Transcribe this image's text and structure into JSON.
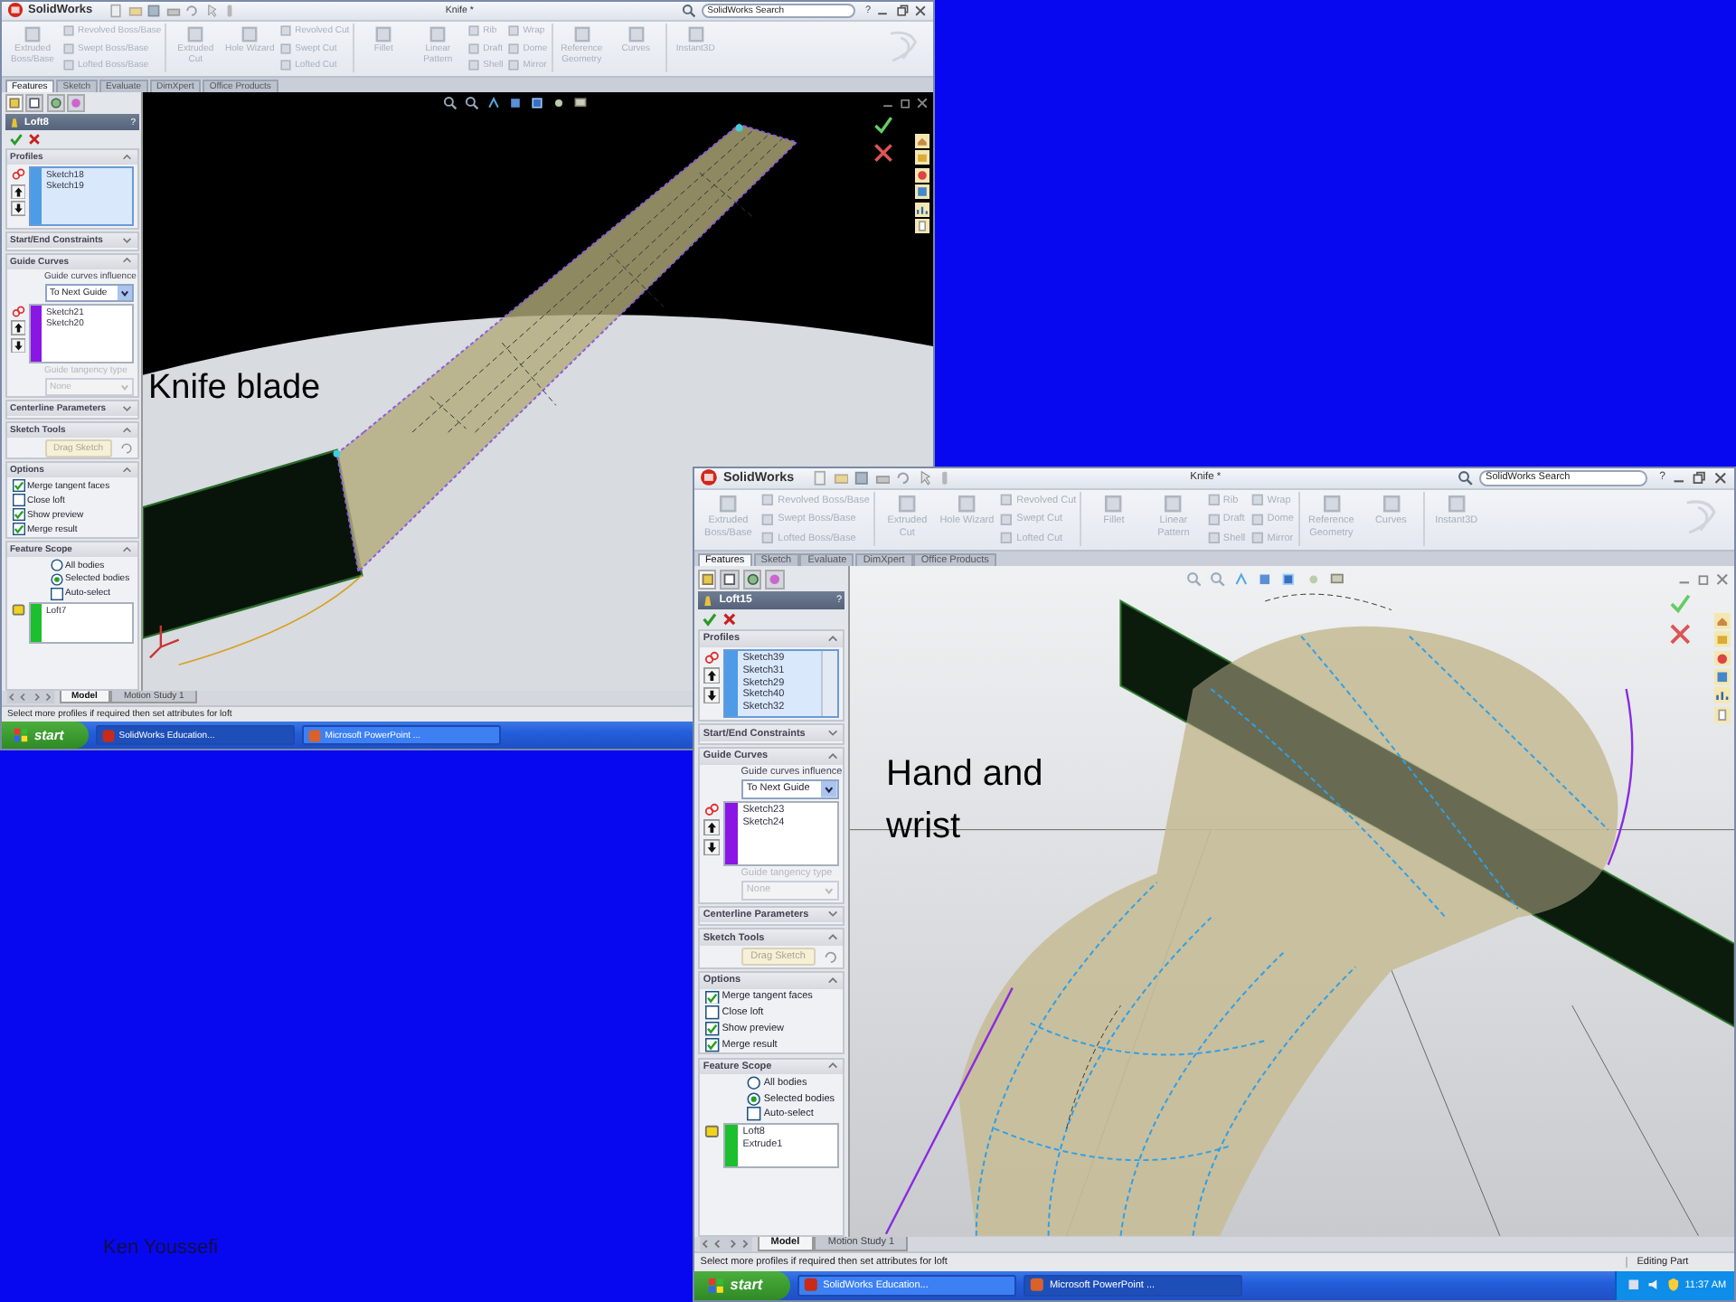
{
  "windows": [
    {
      "kind": "knife",
      "app_name": "SolidWorks",
      "title": "Knife *",
      "search_placeholder": "SolidWorks Search",
      "help": "?",
      "ribbon": [
        {
          "kind": "large",
          "label": "Extruded Boss/Base"
        },
        {
          "kind": "stack",
          "items": [
            "Revolved Boss/Base",
            "Swept Boss/Base",
            "Lofted Boss/Base"
          ]
        },
        {
          "kind": "sep"
        },
        {
          "kind": "large",
          "label": "Extruded Cut"
        },
        {
          "kind": "large",
          "label": "Hole Wizard"
        },
        {
          "kind": "stack",
          "items": [
            "Revolved Cut",
            "Swept Cut",
            "Lofted Cut"
          ]
        },
        {
          "kind": "sep"
        },
        {
          "kind": "large",
          "label": "Fillet"
        },
        {
          "kind": "large",
          "label": "Linear Pattern"
        },
        {
          "kind": "stack",
          "items": [
            "Rib",
            "Draft",
            "Shell"
          ]
        },
        {
          "kind": "stack",
          "items": [
            "Wrap",
            "Dome",
            "Mirror"
          ]
        },
        {
          "kind": "sep"
        },
        {
          "kind": "large",
          "label": "Reference Geometry"
        },
        {
          "kind": "large",
          "label": "Curves"
        },
        {
          "kind": "sep"
        },
        {
          "kind": "large",
          "label": "Instant3D"
        }
      ],
      "command_tabs": [
        {
          "label": "Features",
          "selected": true
        },
        {
          "label": "Sketch",
          "selected": false
        },
        {
          "label": "Evaluate",
          "selected": false
        },
        {
          "label": "DimXpert",
          "selected": false
        },
        {
          "label": "Office Products",
          "selected": false
        }
      ],
      "feature_name": "Loft8",
      "section_titles": [
        "Profiles",
        "Start/End Constraints",
        "Guide Curves",
        "Centerline Parameters",
        "Sketch Tools",
        "Options",
        "Feature Scope"
      ],
      "profiles": [
        "Sketch18",
        "Sketch19"
      ],
      "guide_influence_label": "Guide curves influence",
      "guide_influence": "To Next Guide",
      "guides": [
        "Sketch21",
        "Sketch20"
      ],
      "tangency_label": "Guide tangency type",
      "tangency_value": "None",
      "drag_sketch": "Drag Sketch",
      "options": [
        {
          "label": "Merge tangent faces",
          "checked": true
        },
        {
          "label": "Close loft",
          "checked": false
        },
        {
          "label": "Show preview",
          "checked": true
        },
        {
          "label": "Merge result",
          "checked": true
        }
      ],
      "scope": [
        {
          "label": "All bodies",
          "selected": false
        },
        {
          "label": "Selected bodies",
          "selected": true
        }
      ],
      "auto_select": {
        "label": "Auto-select",
        "checked": false
      },
      "scope_bodies": [
        "Loft7"
      ],
      "bottom_tabs": [
        {
          "label": "Model",
          "selected": true
        },
        {
          "label": "Motion Study 1",
          "selected": false
        }
      ],
      "status_text": "Select more profiles if required then set attributes for loft",
      "taskbar": {
        "start": "start",
        "items": [
          {
            "label": "SolidWorks Education...",
            "selected": true
          },
          {
            "label": "Microsoft PowerPoint ...",
            "selected": false
          }
        ]
      }
    },
    {
      "kind": "hand",
      "app_name": "SolidWorks",
      "title": "Knife *",
      "search_placeholder": "SolidWorks Search",
      "help": "?",
      "ribbon": [
        {
          "kind": "large",
          "label": "Extruded Boss/Base"
        },
        {
          "kind": "stack",
          "items": [
            "Revolved Boss/Base",
            "Swept Boss/Base",
            "Lofted Boss/Base"
          ]
        },
        {
          "kind": "sep"
        },
        {
          "kind": "large",
          "label": "Extruded Cut"
        },
        {
          "kind": "large",
          "label": "Hole Wizard"
        },
        {
          "kind": "stack",
          "items": [
            "Revolved Cut",
            "Swept Cut",
            "Lofted Cut"
          ]
        },
        {
          "kind": "sep"
        },
        {
          "kind": "large",
          "label": "Fillet"
        },
        {
          "kind": "large",
          "label": "Linear Pattern"
        },
        {
          "kind": "stack",
          "items": [
            "Rib",
            "Draft",
            "Shell"
          ]
        },
        {
          "kind": "stack",
          "items": [
            "Wrap",
            "Dome",
            "Mirror"
          ]
        },
        {
          "kind": "sep"
        },
        {
          "kind": "large",
          "label": "Reference Geometry"
        },
        {
          "kind": "large",
          "label": "Curves"
        },
        {
          "kind": "sep"
        },
        {
          "kind": "large",
          "label": "Instant3D"
        }
      ],
      "command_tabs": [
        {
          "label": "Features",
          "selected": true
        },
        {
          "label": "Sketch",
          "selected": false
        },
        {
          "label": "Evaluate",
          "selected": false
        },
        {
          "label": "DimXpert",
          "selected": false
        },
        {
          "label": "Office Products",
          "selected": false
        }
      ],
      "feature_name": "Loft15",
      "section_titles": [
        "Profiles",
        "Start/End Constraints",
        "Guide Curves",
        "Centerline Parameters",
        "Sketch Tools",
        "Options",
        "Feature Scope"
      ],
      "profiles": [
        "Sketch39",
        "Sketch31",
        "Sketch29",
        "Sketch40",
        "Sketch32"
      ],
      "guide_influence_label": "Guide curves influence",
      "guide_influence": "To Next Guide",
      "guides": [
        "Sketch23",
        "Sketch24"
      ],
      "tangency_label": "Guide tangency type",
      "tangency_value": "None",
      "drag_sketch": "Drag Sketch",
      "options": [
        {
          "label": "Merge tangent faces",
          "checked": true
        },
        {
          "label": "Close loft",
          "checked": false
        },
        {
          "label": "Show preview",
          "checked": true
        },
        {
          "label": "Merge result",
          "checked": true
        }
      ],
      "scope": [
        {
          "label": "All bodies",
          "selected": false
        },
        {
          "label": "Selected bodies",
          "selected": true
        }
      ],
      "auto_select": {
        "label": "Auto-select",
        "checked": false
      },
      "scope_bodies": [
        "Loft8",
        "Extrude1"
      ],
      "bottom_tabs": [
        {
          "label": "Model",
          "selected": true
        },
        {
          "label": "Motion Study 1",
          "selected": false
        }
      ],
      "status_text": "Select more profiles if required then set attributes for loft",
      "status_right": "Editing Part",
      "taskbar": {
        "start": "start",
        "items": [
          {
            "label": "SolidWorks Education...",
            "selected": false
          },
          {
            "label": "Microsoft PowerPoint ...",
            "selected": true
          }
        ],
        "clock": "11:37 AM"
      }
    }
  ],
  "captions": [
    "Knife blade",
    "Hand and wrist"
  ],
  "author": "Ken Youssefi"
}
